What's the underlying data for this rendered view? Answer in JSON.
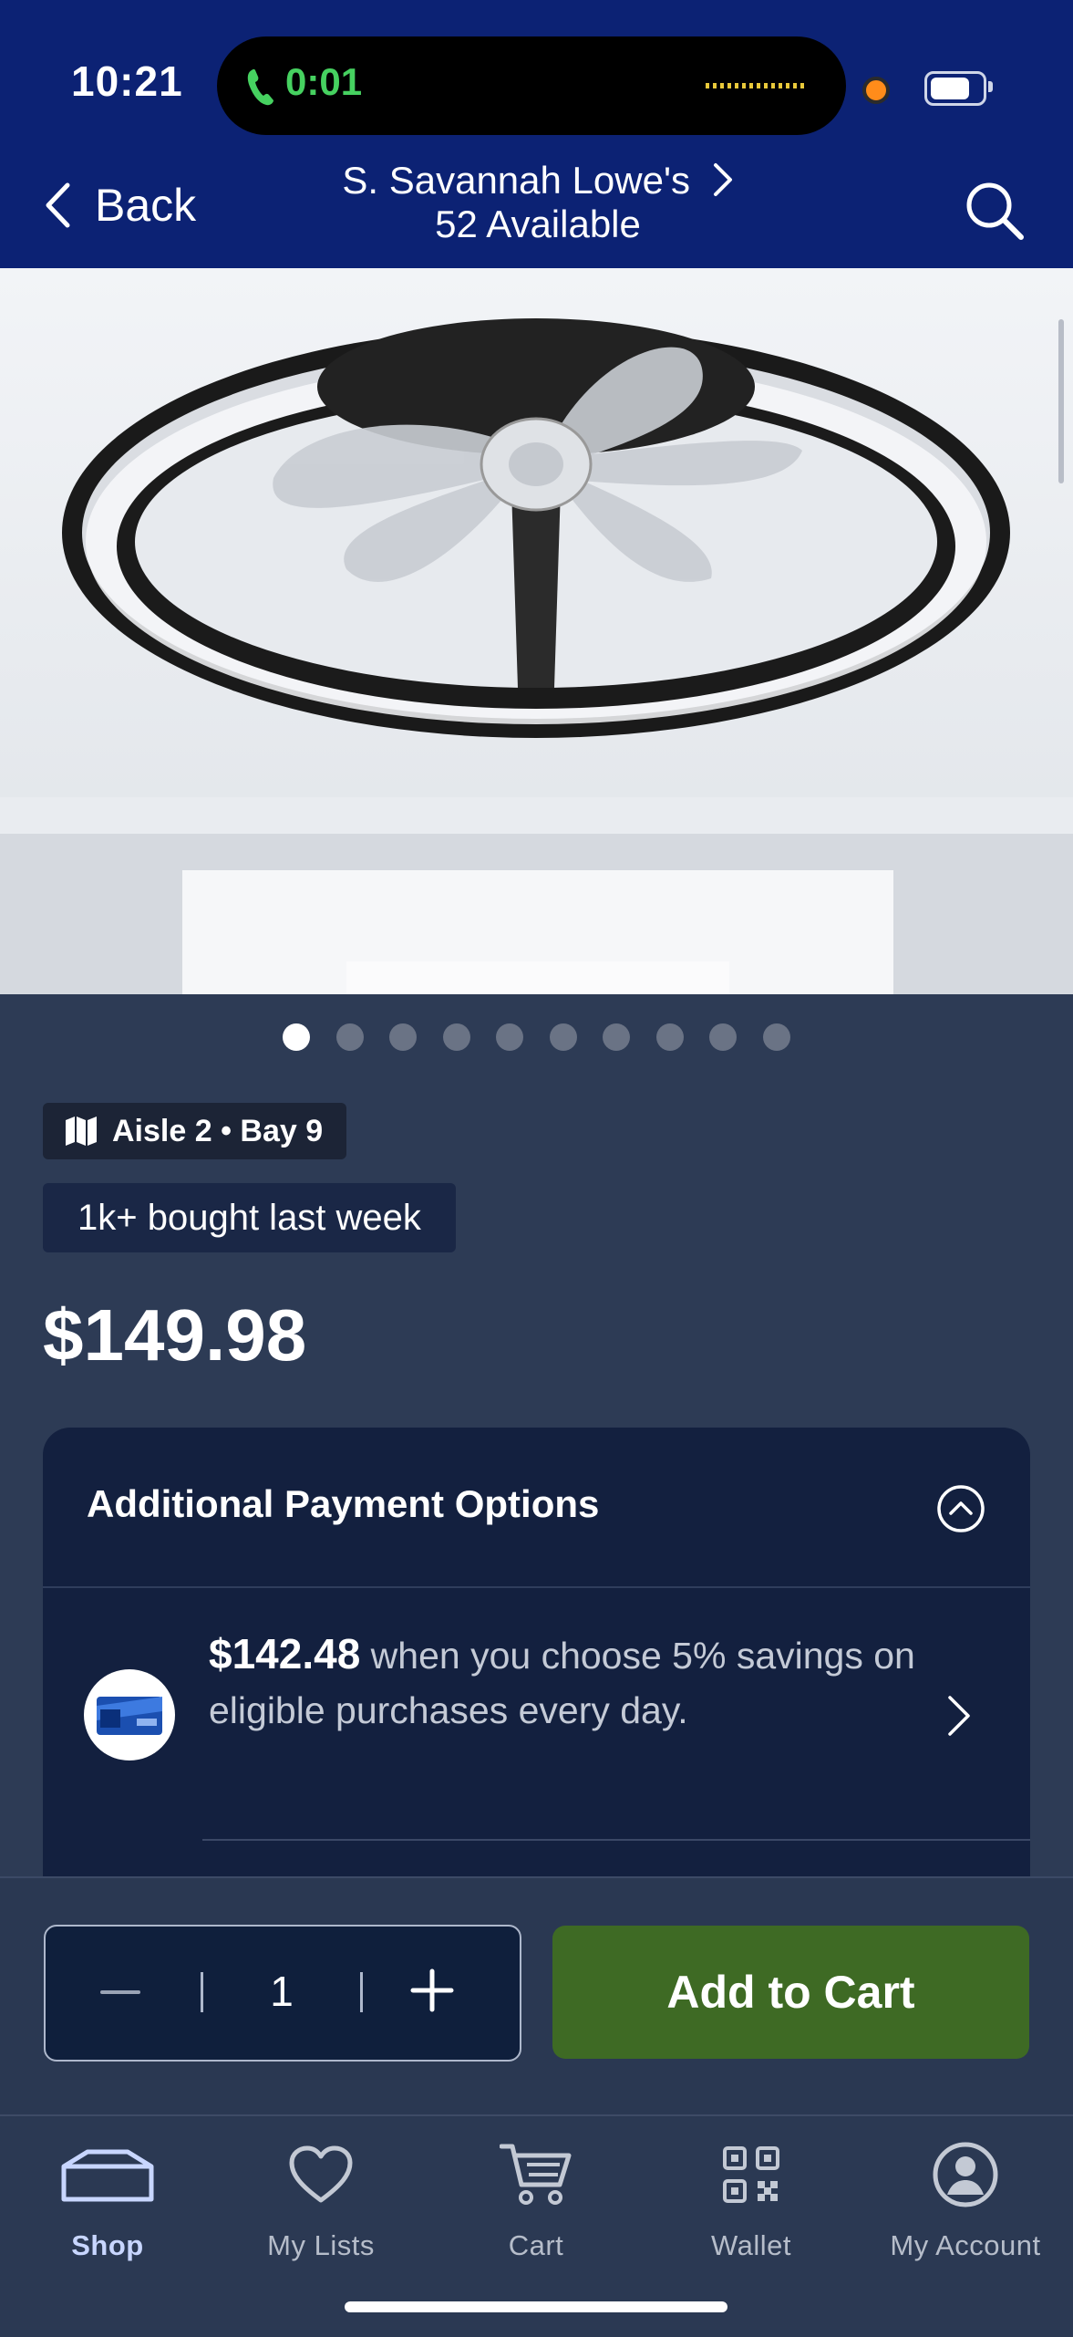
{
  "status_bar": {
    "time": "10:21",
    "call_duration": "0:01"
  },
  "header": {
    "back_label": "Back",
    "store_name": "S. Savannah Lowe's",
    "availability": "52 Available",
    "icons": {
      "back": "chevron-left-icon",
      "store": "chevron-right-icon",
      "search": "search-icon"
    }
  },
  "product": {
    "image": "ceiling-fan-light-photo",
    "gallery": {
      "total": 10,
      "active_index": 0
    },
    "location": {
      "label": "Aisle 2 • Bay 9",
      "icon": "map-icon"
    },
    "social_proof": "1k+ bought last week",
    "price": "$149.98"
  },
  "payment_options": {
    "title": "Additional Payment Options",
    "offer": {
      "amount": "$142.48",
      "text": " when you choose 5% savings on eligible purchases every day."
    }
  },
  "purchase": {
    "quantity": "1",
    "add_to_cart_label": "Add to Cart"
  },
  "tab_bar": {
    "items": [
      {
        "label": "Shop",
        "icon": "home-icon",
        "active": true
      },
      {
        "label": "My Lists",
        "icon": "heart-icon",
        "active": false
      },
      {
        "label": "Cart",
        "icon": "cart-icon",
        "active": false
      },
      {
        "label": "Wallet",
        "icon": "qr-code-icon",
        "active": false
      },
      {
        "label": "My Account",
        "icon": "account-icon",
        "active": false
      }
    ]
  },
  "colors": {
    "header_bg": "#0c2274",
    "page_bg": "#2d3b55",
    "card_bg": "#13203f",
    "add_to_cart_bg": "#3e6a24",
    "call_green": "#46d160",
    "active_tab": "#c8d6ff"
  }
}
